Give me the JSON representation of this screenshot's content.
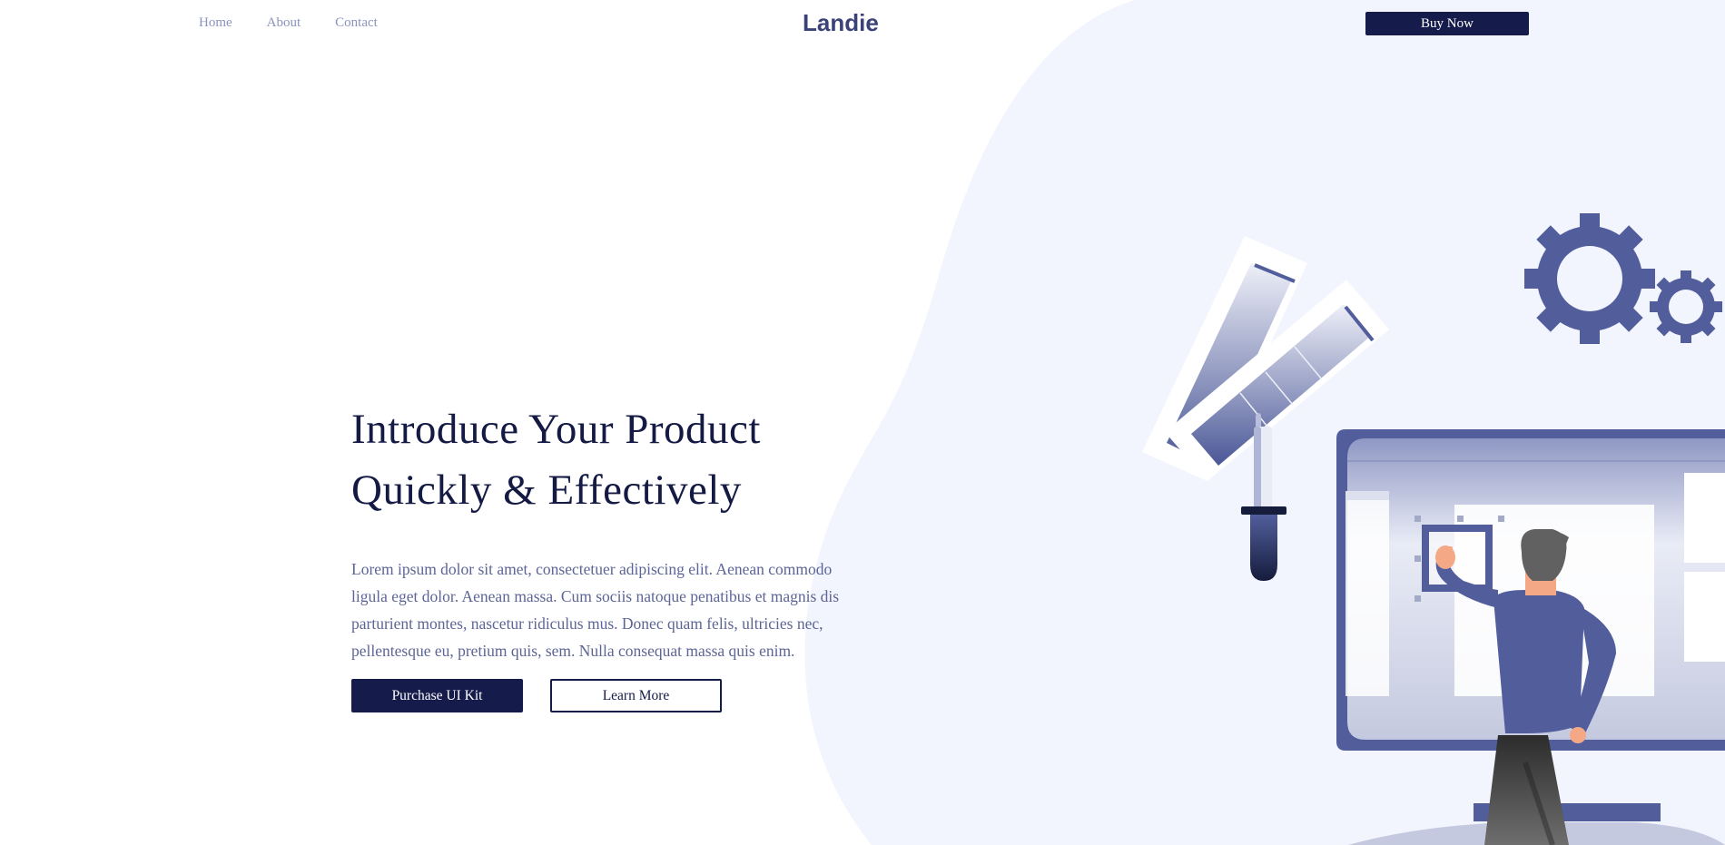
{
  "nav": {
    "links": [
      "Home",
      "About",
      "Contact"
    ],
    "logo": "Landie",
    "buy_label": "Buy Now"
  },
  "hero": {
    "title_line1": "Introduce Your Product",
    "title_line2": "Quickly & Effectively",
    "paragraph": "Lorem ipsum dolor sit amet, consectetuer adipiscing elit. Aenean commodo ligula eget dolor. Aenean massa. Cum sociis natoque penatibus et magnis dis parturient montes, nascetur ridiculus mus. Donec quam felis, ultricies nec, pellentesque eu, pretium quis, sem. Nulla consequat massa quis enim.",
    "primary_button": "Purchase UI Kit",
    "secondary_button": "Learn More"
  },
  "illustration": {
    "subject": "designer-at-monitor",
    "icons": [
      "gear-icon",
      "gear-small-icon",
      "color-swatch-icon",
      "eyedropper-icon"
    ]
  },
  "colors": {
    "brand_dark": "#151c4b",
    "accent": "#525e9c",
    "nav_link": "#8b93bd",
    "bg_blob": "#f2f5fd",
    "body_text": "#5d6596"
  }
}
